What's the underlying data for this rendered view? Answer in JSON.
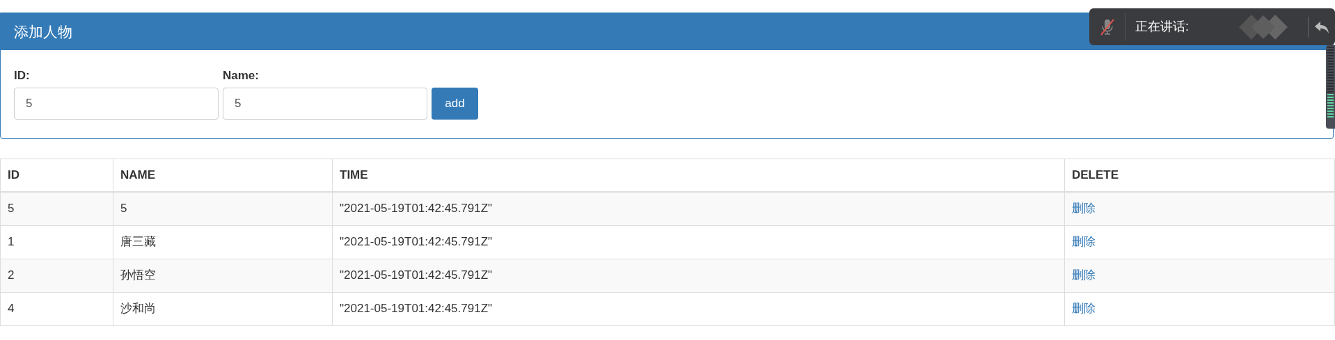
{
  "panel": {
    "title": "添加人物",
    "fields": [
      {
        "label": "ID:",
        "value": "5"
      },
      {
        "label": "Name:",
        "value": "5"
      }
    ],
    "button": "add"
  },
  "table": {
    "columns": [
      "ID",
      "NAME",
      "TIME",
      "DELETE"
    ],
    "rows": [
      {
        "cells": [
          "5",
          "5",
          "\"2021-05-19T01:42:45.791Z\""
        ],
        "action": "删除"
      },
      {
        "cells": [
          "1",
          "唐三藏",
          "\"2021-05-19T01:42:45.791Z\""
        ],
        "action": "删除"
      },
      {
        "cells": [
          "2",
          "孙悟空",
          "\"2021-05-19T01:42:45.791Z\""
        ],
        "action": "删除"
      },
      {
        "cells": [
          "4",
          "沙和尚",
          "\"2021-05-19T01:42:45.791Z\""
        ],
        "action": "删除"
      }
    ]
  },
  "speaking_bar": {
    "label": "正在讲话:",
    "muted": true
  }
}
